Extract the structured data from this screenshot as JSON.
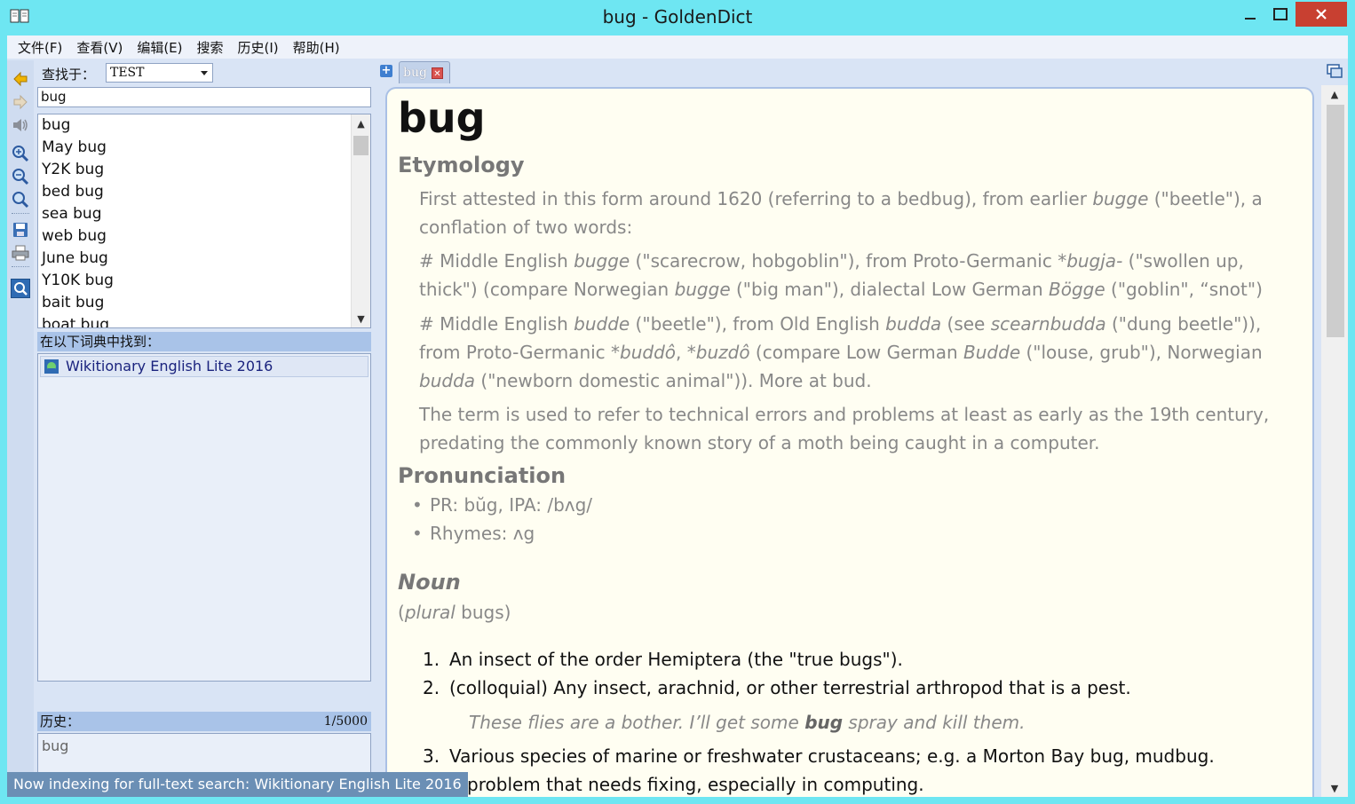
{
  "window": {
    "title": "bug - GoldenDict"
  },
  "menu": {
    "items": [
      "文件(F)",
      "查看(V)",
      "编辑(E)",
      "搜索",
      "历史(I)",
      "帮助(H)"
    ]
  },
  "search": {
    "find_in_label": "查找于：",
    "group_value": "TEST",
    "query": "bug"
  },
  "word_list": [
    "bug",
    "May bug",
    "Y2K bug",
    "bed bug",
    "sea bug",
    "web bug",
    "June bug",
    "Y10K bug",
    "bait bug",
    "boat bug"
  ],
  "found_in": {
    "header": "在以下词典中找到：",
    "dictionaries": [
      "Wikitionary English Lite 2016"
    ]
  },
  "history": {
    "header": "历史：",
    "counter": "1/5000",
    "items": [
      "bug"
    ]
  },
  "status": {
    "text": "Now indexing for full-text search: Wikitionary English Lite 2016"
  },
  "tabs": [
    {
      "label": "bug"
    }
  ],
  "article": {
    "headword": "bug",
    "etymology_heading": "Etymology",
    "etym_p1_a": "First attested in this form around 1620 (referring to a bedbug), from earlier ",
    "etym_p1_b": "bugge",
    "etym_p1_c": " (\"beetle\"), a conflation of two words:",
    "etym_p2_a": "# Middle English ",
    "etym_p2_b": "bugge",
    "etym_p2_c": " (\"scarecrow, hobgoblin\"), from Proto-Germanic ",
    "etym_p2_d": "*bugja-",
    "etym_p2_e": " (\"swollen up, thick\") (compare Norwegian ",
    "etym_p2_f": "bugge",
    "etym_p2_g": " (\"big man\"), dialectal Low German ",
    "etym_p2_h": "Bögge",
    "etym_p2_i": " (\"goblin\", “snot\")",
    "etym_p3_a": "# Middle English ",
    "etym_p3_b": "budde",
    "etym_p3_c": " (\"beetle\"), from Old English ",
    "etym_p3_d": "budda",
    "etym_p3_e": " (see ",
    "etym_p3_f": "scearnbudda",
    "etym_p3_g": " (\"dung beetle\")), from Proto-Germanic ",
    "etym_p3_h": "*buddô",
    "etym_p3_i": ", ",
    "etym_p3_j": "*buzdô",
    "etym_p3_k": " (compare Low German ",
    "etym_p3_l": "Budde",
    "etym_p3_m": " (\"louse, grub\"), Norwegian ",
    "etym_p3_n": "budda",
    "etym_p3_o": " (\"newborn domestic animal\")). More at bud.",
    "etym_p4": "The term is used to refer to technical errors and problems at least as early as the 19th century, predating the commonly known story of a moth being caught in a computer.",
    "pronunciation_heading": "Pronunciation",
    "pron_1": "PR: bŭg, IPA: /bʌg/",
    "pron_2": "Rhymes: ʌg",
    "pos_heading": "Noun",
    "plural_open": "(",
    "plural_word": "plural",
    "plural_rest": " bugs)",
    "def_1_num": "1.",
    "def_1": "An insect of the order Hemiptera (the \"true bugs\").",
    "def_2_num": "2.",
    "def_2": "(colloquial) Any insect, arachnid, or other terrestrial arthropod that is a pest.",
    "ex_2_a": "These flies are a bother. I’ll get some ",
    "ex_2_b": "bug",
    "ex_2_c": " spray and kill them.",
    "def_3_num": "3.",
    "def_3": "Various species of marine or freshwater crustaceans; e.g. a Morton Bay bug, mudbug.",
    "def_4": "A problem that needs fixing, especially in computing."
  },
  "colors": {
    "titlebar": "#6ee6f2",
    "close": "#c84031",
    "panel": "#d9e4f5",
    "article_bg": "#fffef2",
    "status": "#6b8fb5"
  }
}
